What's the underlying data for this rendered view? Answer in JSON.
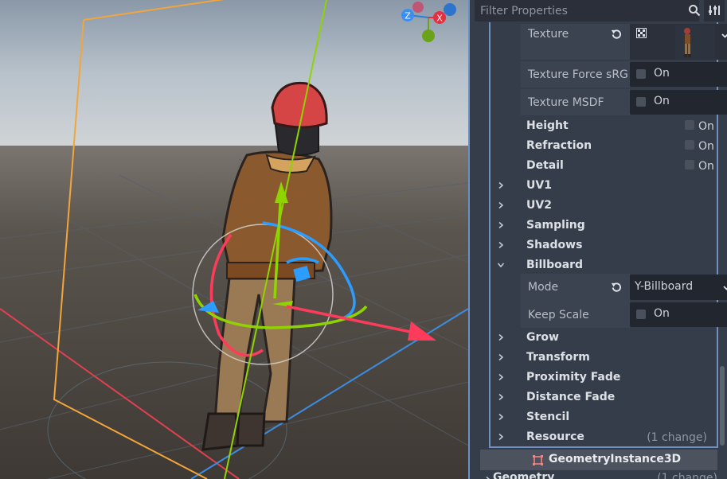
{
  "filter": {
    "placeholder": "Filter Properties"
  },
  "viewport": {
    "gizmo": {
      "x_label": "X",
      "z_label": "Z"
    }
  },
  "properties": {
    "texture": {
      "label": "Texture"
    },
    "texture_force_srgb": {
      "label": "Texture Force sRG",
      "value": "On"
    },
    "texture_msdf": {
      "label": "Texture MSDF",
      "value": "On"
    },
    "height": {
      "label": "Height",
      "value": "On"
    },
    "refraction": {
      "label": "Refraction",
      "value": "On"
    },
    "detail": {
      "label": "Detail",
      "value": "On"
    },
    "uv1": {
      "label": "UV1"
    },
    "uv2": {
      "label": "UV2"
    },
    "sampling": {
      "label": "Sampling"
    },
    "shadows": {
      "label": "Shadows"
    },
    "billboard": {
      "label": "Billboard"
    },
    "billboard_mode": {
      "label": "Mode",
      "value": "Y-Billboard"
    },
    "keep_scale": {
      "label": "Keep Scale",
      "value": "On"
    },
    "grow": {
      "label": "Grow"
    },
    "transform": {
      "label": "Transform"
    },
    "proximity_fade": {
      "label": "Proximity Fade"
    },
    "distance_fade": {
      "label": "Distance Fade"
    },
    "stencil": {
      "label": "Stencil"
    },
    "resource": {
      "label": "Resource",
      "note": "(1 change)"
    }
  },
  "geometry_instance": {
    "label": "GeometryInstance3D"
  },
  "geometry": {
    "label": "Geometry",
    "note": "(1 change)"
  },
  "colors": {
    "accent": "#6f8fc0",
    "panel_bg": "#363d4a",
    "x_axis": "#ff3b5c",
    "y_axis": "#8fd400",
    "z_axis": "#2d9cff"
  }
}
